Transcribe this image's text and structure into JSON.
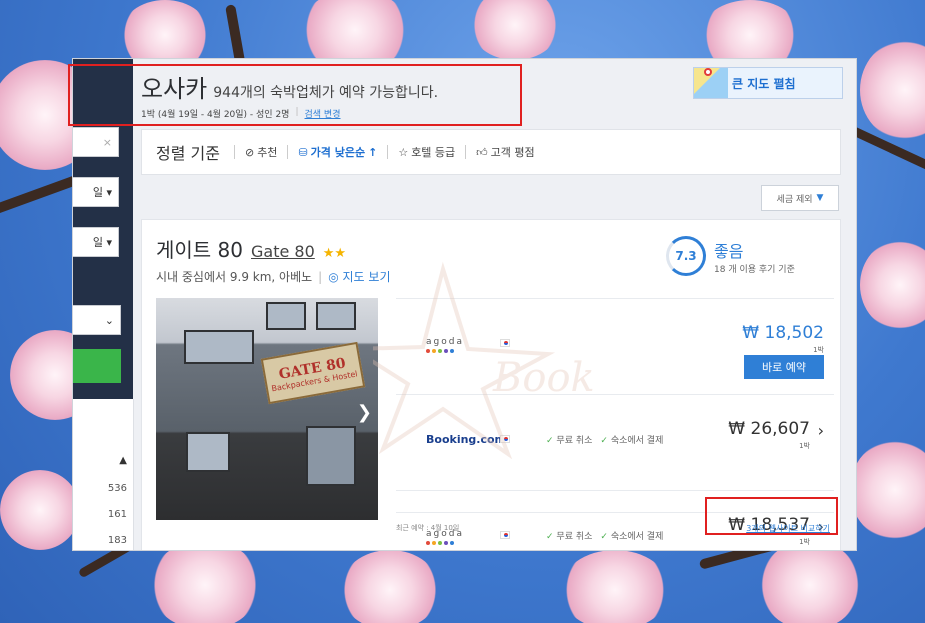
{
  "search": {
    "city": "오사카",
    "count_text": "944개의 숙박업체가 예약 가능합니다.",
    "details": "1박 (4월 19일 - 4월 20일) - 성인 2명",
    "change_link": "검색 변경"
  },
  "map_button": {
    "label": "큰 지도 펼침",
    "icon": "map-pin-icon"
  },
  "sort": {
    "heading": "정렬 기준",
    "options": [
      {
        "label": "추천",
        "icon": "check-circle-icon",
        "active": false
      },
      {
        "label": "가격 낮은순",
        "icon": "coins-icon",
        "arrow": "↑",
        "active": true
      },
      {
        "label": "호텔 등급",
        "icon": "star-outline-icon",
        "active": false
      },
      {
        "label": "고객 평점",
        "icon": "thumbs-up-icon",
        "active": false
      }
    ]
  },
  "tax_button": {
    "label": "세금 제외",
    "caret": "▼"
  },
  "sidebar": {
    "fields": [
      "일",
      "일"
    ],
    "counts": [
      "536",
      "161",
      "183"
    ]
  },
  "hotel": {
    "name_ko": "게이트 80",
    "name_en": "Gate 80",
    "stars": "★★",
    "star_count": 2,
    "location": "시내 중심에서 9.9 km, 아베노",
    "map_link": "지도 보기",
    "rating_score": "7.3",
    "rating_label": "좋음",
    "review_text": "18 개 이용 후기 기준",
    "photo_sign_main": "GATE 80",
    "photo_sign_sub": "Backpackers & Hostel"
  },
  "offers": [
    {
      "site": "agoda",
      "price": "₩ 18,502",
      "per": "1박",
      "button": "바로 예약",
      "perks": []
    },
    {
      "site": "Booking.com",
      "price": "₩ 26,607",
      "per": "1박",
      "perks": [
        "무료 취소",
        "숙소에서 결제"
      ]
    },
    {
      "site": "agoda",
      "price": "₩ 18,537",
      "per": "1박",
      "perks": [
        "무료 취소",
        "숙소에서 결제"
      ]
    }
  ],
  "footer": {
    "recent": "최근 예약 : 4월 10일",
    "compare": "3개의 웹사이트 비교하기"
  },
  "watermark": "Book",
  "colors": {
    "accent": "#2f7fd6",
    "sidebar": "#233047",
    "book_button": "#2f7fd6",
    "highlight_box": "#e02020"
  }
}
